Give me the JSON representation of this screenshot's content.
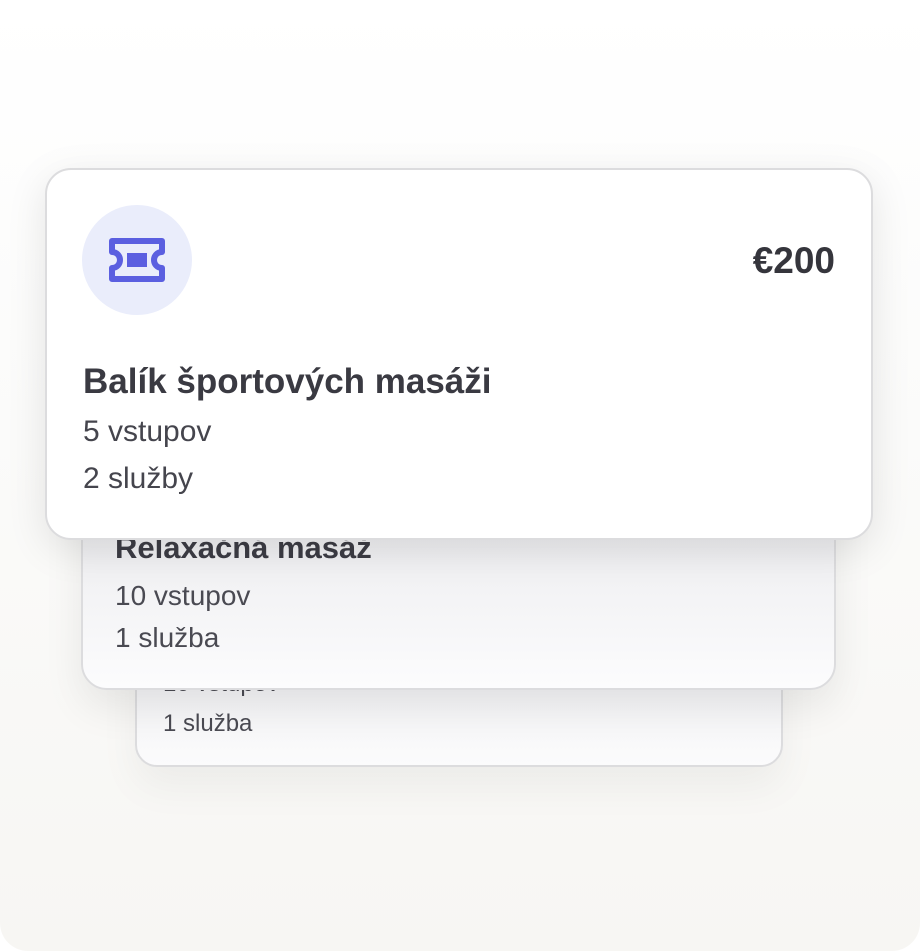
{
  "cards": [
    {
      "title": "",
      "entries": "10 vstupov",
      "services": "1 služba"
    },
    {
      "title": "Relaxačná masáž",
      "entries": "10 vstupov",
      "services": "1 služba"
    },
    {
      "icon": "ticket-icon",
      "price": "€200",
      "title": "Balík športových masáži",
      "entries": "5 vstupov",
      "services": "2 služby"
    }
  ],
  "colors": {
    "accent": "#5b5fe0",
    "icon_bg": "#eaedfb",
    "text": "#3f3f46"
  }
}
